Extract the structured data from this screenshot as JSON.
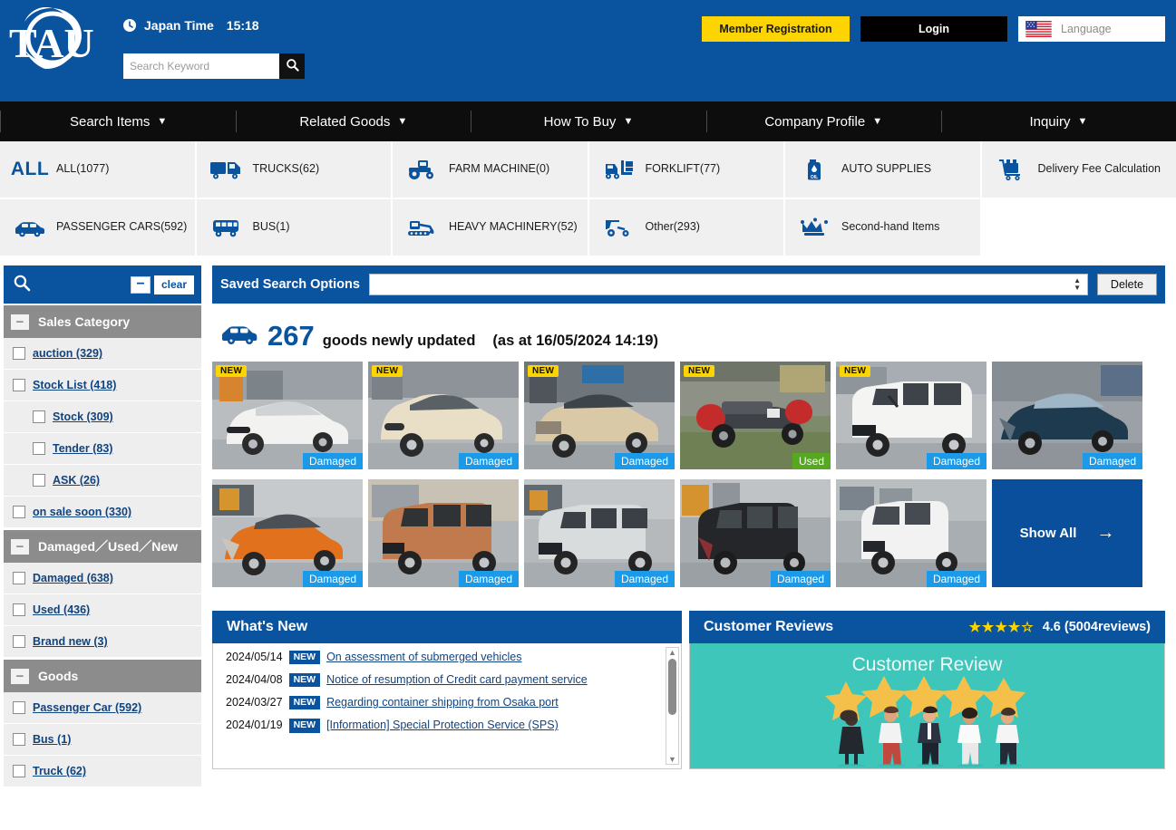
{
  "header": {
    "logo_text": "TAU",
    "clock_icon": "clock-icon",
    "time_label": "Japan Time",
    "time_value": "15:18",
    "search_placeholder": "Search Keyword",
    "search_value": "",
    "search_icon": "search-icon",
    "member_registration": "Member Registration",
    "login": "Login",
    "language": "Language",
    "flag_icon": "us-flag-icon"
  },
  "nav": {
    "items": [
      {
        "label": "Search Items",
        "caret": "⌄"
      },
      {
        "label": "Related Goods",
        "caret": "⌄"
      },
      {
        "label": "How To Buy",
        "caret": "⌄"
      },
      {
        "label": "Company Profile",
        "caret": "⌄"
      },
      {
        "label": "Inquiry",
        "caret": "⌄"
      }
    ]
  },
  "categories": [
    {
      "label": "ALL(1077)",
      "icon": "all-text-icon",
      "word": "ALL"
    },
    {
      "label": "TRUCKS(62)",
      "icon": "truck-icon"
    },
    {
      "label": "FARM MACHINE(0)",
      "icon": "tractor-icon"
    },
    {
      "label": "FORKLIFT(77)",
      "icon": "forklift-icon"
    },
    {
      "label": "AUTO SUPPLIES",
      "icon": "oil-bottle-icon"
    },
    {
      "label": "Delivery Fee Calculation",
      "icon": "delivery-cart-icon"
    },
    {
      "label": "PASSENGER CARS(592)",
      "icon": "car-icon"
    },
    {
      "label": "BUS(1)",
      "icon": "bus-icon"
    },
    {
      "label": "HEAVY MACHINERY(52)",
      "icon": "excavator-icon"
    },
    {
      "label": "Other(293)",
      "icon": "buggy-icon"
    },
    {
      "label": "Second-hand Items",
      "icon": "crown-icon"
    },
    {
      "label": "",
      "icon": ""
    }
  ],
  "sidebar": {
    "search_icon": "search-icon",
    "collapse_icon": "minus-icon",
    "clear_label": "clear",
    "groups": [
      {
        "title": "Sales Category",
        "items": [
          {
            "label": "auction (329)",
            "indent": false
          },
          {
            "label": "Stock List (418)",
            "indent": false
          },
          {
            "label": "Stock (309)",
            "indent": true
          },
          {
            "label": "Tender (83)",
            "indent": true
          },
          {
            "label": "ASK (26)",
            "indent": true
          },
          {
            "label": "on sale soon (330)",
            "indent": false
          }
        ]
      },
      {
        "title": "Damaged／Used／New",
        "items": [
          {
            "label": "Damaged (638)",
            "indent": false
          },
          {
            "label": "Used (436)",
            "indent": false
          },
          {
            "label": "Brand new (3)",
            "indent": false
          }
        ]
      },
      {
        "title": "Goods",
        "items": [
          {
            "label": "Passenger Car (592)",
            "indent": false
          },
          {
            "label": "Bus (1)",
            "indent": false
          },
          {
            "label": "Truck (62)",
            "indent": false
          }
        ]
      }
    ]
  },
  "saved_search": {
    "label": "Saved Search Options",
    "selected_value": "",
    "delete_label": "Delete"
  },
  "results": {
    "count": "267",
    "count_text": "goods newly updated",
    "as_at": "(as at 16/05/2024 14:19)",
    "car_icon": "car-icon"
  },
  "thumbnails": [
    {
      "new": "NEW",
      "state": "Damaged",
      "alt": "white-suv"
    },
    {
      "new": "NEW",
      "state": "Damaged",
      "alt": "beige-hatchback"
    },
    {
      "new": "NEW",
      "state": "Damaged",
      "alt": "tan-crossover"
    },
    {
      "new": "NEW",
      "state": "Used",
      "alt": "red-grey-roadster"
    },
    {
      "new": "NEW",
      "state": "Damaged",
      "alt": "white-van"
    },
    {
      "new": "",
      "state": "Damaged",
      "alt": "dark-blue-suv"
    },
    {
      "new": "",
      "state": "Damaged",
      "alt": "orange-compact"
    },
    {
      "new": "",
      "state": "Damaged",
      "alt": "copper-minivan"
    },
    {
      "new": "",
      "state": "Damaged",
      "alt": "silver-minivan"
    },
    {
      "new": "",
      "state": "Damaged",
      "alt": "black-minivan"
    },
    {
      "new": "",
      "state": "Damaged",
      "alt": "white-minivan"
    }
  ],
  "show_all": {
    "label": "Show All",
    "arrow": "→"
  },
  "whats_new": {
    "title": "What's New",
    "items": [
      {
        "date": "2024/05/14",
        "tag": "NEW",
        "text": "On assessment of submerged vehicles"
      },
      {
        "date": "2024/04/08",
        "tag": "NEW",
        "text": "Notice of resumption of Credit card payment service"
      },
      {
        "date": "2024/03/27",
        "tag": "NEW",
        "text": "Regarding container shipping from Osaka port"
      },
      {
        "date": "2024/01/19",
        "tag": "NEW",
        "text": "[Information] Special Protection Service (SPS)"
      }
    ]
  },
  "customer_reviews": {
    "title": "Customer Reviews",
    "stars": "★★★★☆",
    "rating_text": "4.6 (5004reviews)",
    "banner_title": "Customer Review"
  },
  "colors": {
    "brand_blue": "#0a549f",
    "yellow": "#fbd402",
    "badge_blue": "#1a9ae8",
    "badge_green": "#55a820",
    "gray_group": "#8c8c8c",
    "teal": "#3ec6bb"
  }
}
